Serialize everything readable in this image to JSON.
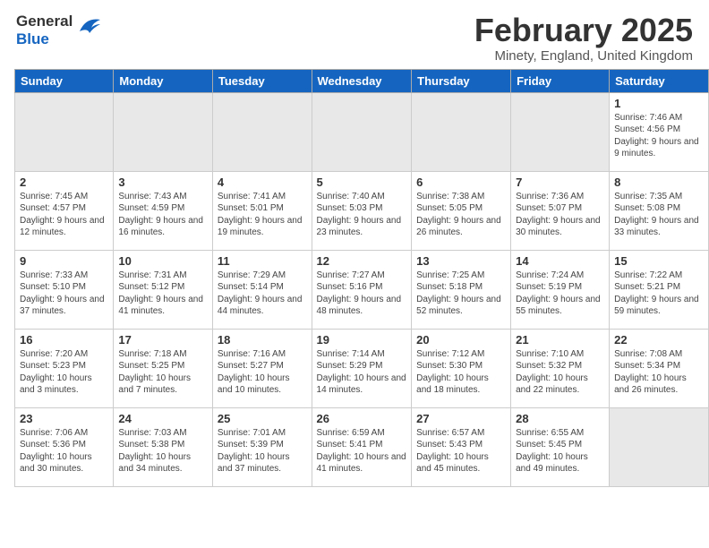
{
  "header": {
    "logo_general": "General",
    "logo_blue": "Blue",
    "month_year": "February 2025",
    "location": "Minety, England, United Kingdom"
  },
  "days_of_week": [
    "Sunday",
    "Monday",
    "Tuesday",
    "Wednesday",
    "Thursday",
    "Friday",
    "Saturday"
  ],
  "weeks": [
    [
      {
        "day": "",
        "info": "",
        "shaded": true
      },
      {
        "day": "",
        "info": "",
        "shaded": true
      },
      {
        "day": "",
        "info": "",
        "shaded": true
      },
      {
        "day": "",
        "info": "",
        "shaded": true
      },
      {
        "day": "",
        "info": "",
        "shaded": true
      },
      {
        "day": "",
        "info": "",
        "shaded": true
      },
      {
        "day": "1",
        "info": "Sunrise: 7:46 AM\nSunset: 4:56 PM\nDaylight: 9 hours and 9 minutes."
      }
    ],
    [
      {
        "day": "2",
        "info": "Sunrise: 7:45 AM\nSunset: 4:57 PM\nDaylight: 9 hours and 12 minutes."
      },
      {
        "day": "3",
        "info": "Sunrise: 7:43 AM\nSunset: 4:59 PM\nDaylight: 9 hours and 16 minutes."
      },
      {
        "day": "4",
        "info": "Sunrise: 7:41 AM\nSunset: 5:01 PM\nDaylight: 9 hours and 19 minutes."
      },
      {
        "day": "5",
        "info": "Sunrise: 7:40 AM\nSunset: 5:03 PM\nDaylight: 9 hours and 23 minutes."
      },
      {
        "day": "6",
        "info": "Sunrise: 7:38 AM\nSunset: 5:05 PM\nDaylight: 9 hours and 26 minutes."
      },
      {
        "day": "7",
        "info": "Sunrise: 7:36 AM\nSunset: 5:07 PM\nDaylight: 9 hours and 30 minutes."
      },
      {
        "day": "8",
        "info": "Sunrise: 7:35 AM\nSunset: 5:08 PM\nDaylight: 9 hours and 33 minutes."
      }
    ],
    [
      {
        "day": "9",
        "info": "Sunrise: 7:33 AM\nSunset: 5:10 PM\nDaylight: 9 hours and 37 minutes."
      },
      {
        "day": "10",
        "info": "Sunrise: 7:31 AM\nSunset: 5:12 PM\nDaylight: 9 hours and 41 minutes."
      },
      {
        "day": "11",
        "info": "Sunrise: 7:29 AM\nSunset: 5:14 PM\nDaylight: 9 hours and 44 minutes."
      },
      {
        "day": "12",
        "info": "Sunrise: 7:27 AM\nSunset: 5:16 PM\nDaylight: 9 hours and 48 minutes."
      },
      {
        "day": "13",
        "info": "Sunrise: 7:25 AM\nSunset: 5:18 PM\nDaylight: 9 hours and 52 minutes."
      },
      {
        "day": "14",
        "info": "Sunrise: 7:24 AM\nSunset: 5:19 PM\nDaylight: 9 hours and 55 minutes."
      },
      {
        "day": "15",
        "info": "Sunrise: 7:22 AM\nSunset: 5:21 PM\nDaylight: 9 hours and 59 minutes."
      }
    ],
    [
      {
        "day": "16",
        "info": "Sunrise: 7:20 AM\nSunset: 5:23 PM\nDaylight: 10 hours and 3 minutes."
      },
      {
        "day": "17",
        "info": "Sunrise: 7:18 AM\nSunset: 5:25 PM\nDaylight: 10 hours and 7 minutes."
      },
      {
        "day": "18",
        "info": "Sunrise: 7:16 AM\nSunset: 5:27 PM\nDaylight: 10 hours and 10 minutes."
      },
      {
        "day": "19",
        "info": "Sunrise: 7:14 AM\nSunset: 5:29 PM\nDaylight: 10 hours and 14 minutes."
      },
      {
        "day": "20",
        "info": "Sunrise: 7:12 AM\nSunset: 5:30 PM\nDaylight: 10 hours and 18 minutes."
      },
      {
        "day": "21",
        "info": "Sunrise: 7:10 AM\nSunset: 5:32 PM\nDaylight: 10 hours and 22 minutes."
      },
      {
        "day": "22",
        "info": "Sunrise: 7:08 AM\nSunset: 5:34 PM\nDaylight: 10 hours and 26 minutes."
      }
    ],
    [
      {
        "day": "23",
        "info": "Sunrise: 7:06 AM\nSunset: 5:36 PM\nDaylight: 10 hours and 30 minutes."
      },
      {
        "day": "24",
        "info": "Sunrise: 7:03 AM\nSunset: 5:38 PM\nDaylight: 10 hours and 34 minutes."
      },
      {
        "day": "25",
        "info": "Sunrise: 7:01 AM\nSunset: 5:39 PM\nDaylight: 10 hours and 37 minutes."
      },
      {
        "day": "26",
        "info": "Sunrise: 6:59 AM\nSunset: 5:41 PM\nDaylight: 10 hours and 41 minutes."
      },
      {
        "day": "27",
        "info": "Sunrise: 6:57 AM\nSunset: 5:43 PM\nDaylight: 10 hours and 45 minutes."
      },
      {
        "day": "28",
        "info": "Sunrise: 6:55 AM\nSunset: 5:45 PM\nDaylight: 10 hours and 49 minutes."
      },
      {
        "day": "",
        "info": "",
        "shaded": true
      }
    ]
  ]
}
